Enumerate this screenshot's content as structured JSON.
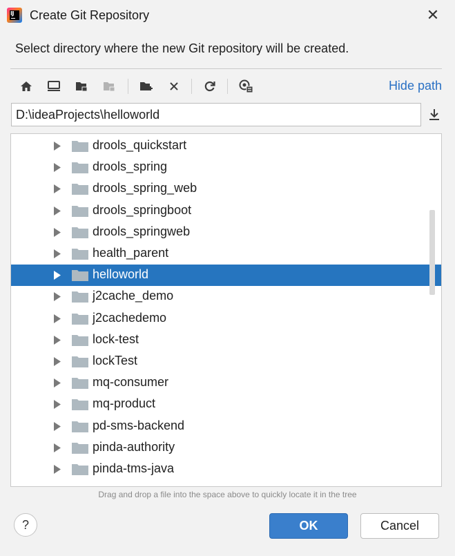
{
  "window": {
    "title": "Create Git Repository",
    "close_glyph": "✕"
  },
  "instruction": "Select directory where the new Git repository will be created.",
  "toolbar": {
    "icons": [
      "home-icon",
      "desktop-icon",
      "project-folder-icon",
      "module-folder-icon",
      "new-folder-icon",
      "delete-icon",
      "refresh-icon",
      "show-hidden-icon"
    ],
    "hide_path_label": "Hide path"
  },
  "path": {
    "value": "D:\\ideaProjects\\helloworld"
  },
  "tree": {
    "items": [
      {
        "label": "drools_quickstart",
        "selected": false
      },
      {
        "label": "drools_spring",
        "selected": false
      },
      {
        "label": "drools_spring_web",
        "selected": false
      },
      {
        "label": "drools_springboot",
        "selected": false
      },
      {
        "label": "drools_springweb",
        "selected": false
      },
      {
        "label": "health_parent",
        "selected": false
      },
      {
        "label": "helloworld",
        "selected": true
      },
      {
        "label": "j2cache_demo",
        "selected": false
      },
      {
        "label": "j2cachedemo",
        "selected": false
      },
      {
        "label": "lock-test",
        "selected": false
      },
      {
        "label": "lockTest",
        "selected": false
      },
      {
        "label": "mq-consumer",
        "selected": false
      },
      {
        "label": "mq-product",
        "selected": false
      },
      {
        "label": "pd-sms-backend",
        "selected": false
      },
      {
        "label": "pinda-authority",
        "selected": false
      },
      {
        "label": "pinda-tms-java",
        "selected": false
      }
    ]
  },
  "hint": "Drag and drop a file into the space above to quickly locate it in the tree",
  "footer": {
    "help_label": "?",
    "ok_label": "OK",
    "cancel_label": "Cancel"
  },
  "colors": {
    "accent": "#2675bf",
    "link": "#2970c4",
    "folder": "#aeb9c0",
    "ok_button": "#3a7fcc"
  }
}
